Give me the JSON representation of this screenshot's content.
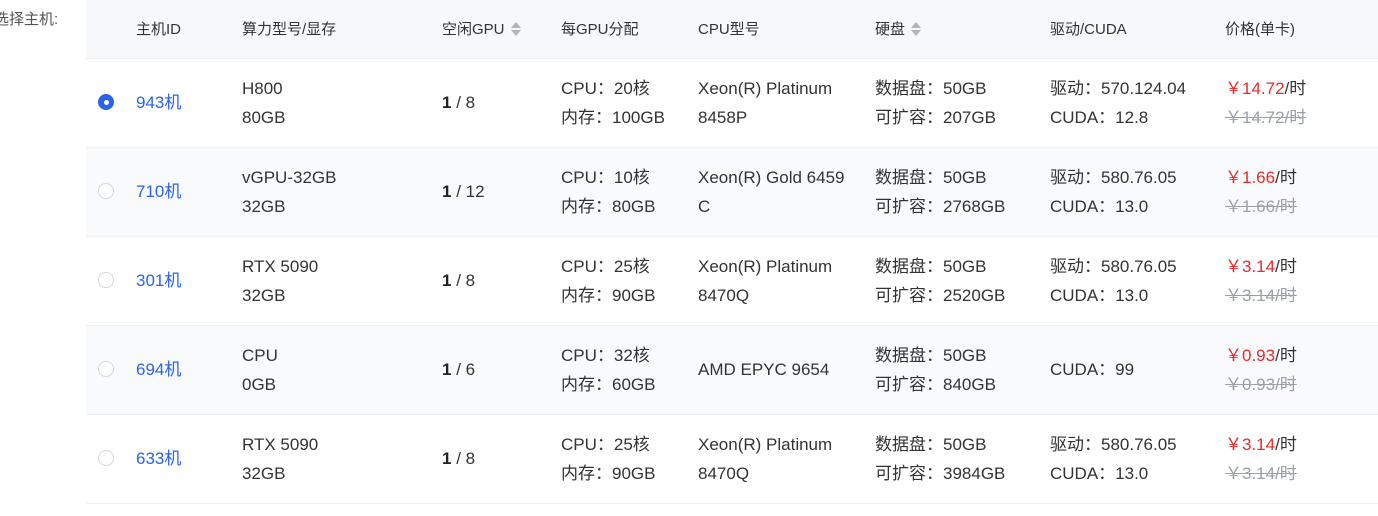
{
  "side_label": "选择主机:",
  "header": {
    "host_id": "主机ID",
    "model_vram": "算力型号/显存",
    "free_gpu": "空闲GPU",
    "per_gpu": "每GPU分配",
    "cpu_model": "CPU型号",
    "disk": "硬盘",
    "driver_cuda": "驱动/CUDA",
    "price": "价格(单卡)"
  },
  "rows": [
    {
      "selected": true,
      "host": "943机",
      "model": "H800",
      "vram": "80GB",
      "free": "1",
      "total": "/ 8",
      "cpu": "CPU：20核",
      "mem": "内存：100GB",
      "cpu_model_1": "Xeon(R) Platinum",
      "cpu_model_2": "8458P",
      "disk_data": "数据盘：50GB",
      "disk_ext": "可扩容：207GB",
      "driver": "驱动：570.124.04",
      "cuda": "CUDA：12.8",
      "price": "￥14.72",
      "price_unit": "/时",
      "price_old": "￥14.72/时"
    },
    {
      "selected": false,
      "host": "710机",
      "model": "vGPU-32GB",
      "vram": "32GB",
      "free": "1",
      "total": "/ 12",
      "cpu": "CPU：10核",
      "mem": "内存：80GB",
      "cpu_model_1": "Xeon(R) Gold 6459",
      "cpu_model_2": "C",
      "disk_data": "数据盘：50GB",
      "disk_ext": "可扩容：2768GB",
      "driver": "驱动：580.76.05",
      "cuda": "CUDA：13.0",
      "price": "￥1.66",
      "price_unit": "/时",
      "price_old": "￥1.66/时"
    },
    {
      "selected": false,
      "host": "301机",
      "model": "RTX 5090",
      "vram": "32GB",
      "free": "1",
      "total": "/ 8",
      "cpu": "CPU：25核",
      "mem": "内存：90GB",
      "cpu_model_1": "Xeon(R) Platinum",
      "cpu_model_2": "8470Q",
      "disk_data": "数据盘：50GB",
      "disk_ext": "可扩容：2520GB",
      "driver": "驱动：580.76.05",
      "cuda": "CUDA：13.0",
      "price": "￥3.14",
      "price_unit": "/时",
      "price_old": "￥3.14/时"
    },
    {
      "selected": false,
      "host": "694机",
      "model": "CPU",
      "vram": "0GB",
      "free": "1",
      "total": "/ 6",
      "cpu": "CPU：32核",
      "mem": "内存：60GB",
      "cpu_model_1": "AMD EPYC 9654",
      "cpu_model_2": "",
      "disk_data": "数据盘：50GB",
      "disk_ext": "可扩容：840GB",
      "driver": "",
      "cuda": "CUDA：99",
      "price": "￥0.93",
      "price_unit": "/时",
      "price_old": "￥0.93/时"
    },
    {
      "selected": false,
      "host": "633机",
      "model": "RTX 5090",
      "vram": "32GB",
      "free": "1",
      "total": "/ 8",
      "cpu": "CPU：25核",
      "mem": "内存：90GB",
      "cpu_model_1": "Xeon(R) Platinum",
      "cpu_model_2": "8470Q",
      "disk_data": "数据盘：50GB",
      "disk_ext": "可扩容：3984GB",
      "driver": "驱动：580.76.05",
      "cuda": "CUDA：13.0",
      "price": "￥3.14",
      "price_unit": "/时",
      "price_old": "￥3.14/时"
    }
  ],
  "colors": {
    "accent": "#2a63e8",
    "price": "#e62b2b",
    "header_bg": "#f7f8fa"
  }
}
